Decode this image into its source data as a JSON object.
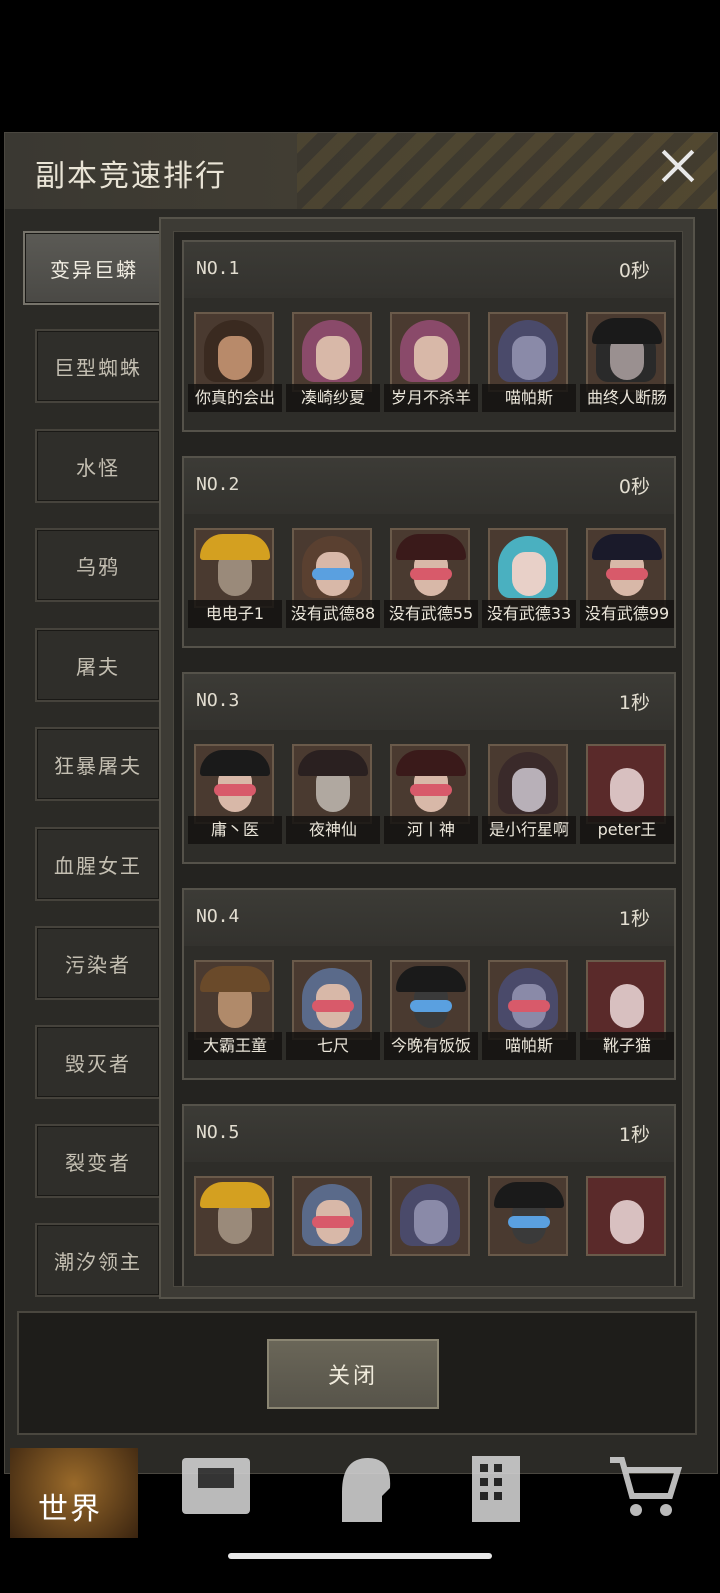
{
  "dialog": {
    "title": "副本竞速排行",
    "close_button": "关闭"
  },
  "sidebar": [
    {
      "label": "变异巨蟒",
      "active": true
    },
    {
      "label": "巨型蜘蛛"
    },
    {
      "label": "水怪"
    },
    {
      "label": "乌鸦"
    },
    {
      "label": "屠夫"
    },
    {
      "label": "狂暴屠夫"
    },
    {
      "label": "血腥女王"
    },
    {
      "label": "污染者"
    },
    {
      "label": "毁灭者"
    },
    {
      "label": "裂变者"
    },
    {
      "label": "潮汐领主"
    }
  ],
  "rankings": [
    {
      "rank": "NO.1",
      "time": "0秒",
      "players": [
        "你真的会出",
        "凑崎纱夏",
        "岁月不杀羊",
        "喵帕斯",
        "曲终人断肠"
      ]
    },
    {
      "rank": "NO.2",
      "time": "0秒",
      "players": [
        "电电子1",
        "没有武德88",
        "没有武德55",
        "没有武德33",
        "没有武德99"
      ]
    },
    {
      "rank": "NO.3",
      "time": "1秒",
      "players": [
        "庸丶医",
        "夜神仙",
        "河丨神",
        "是小行星啊",
        "peter王"
      ]
    },
    {
      "rank": "NO.4",
      "time": "1秒",
      "players": [
        "大霸王童",
        "七尺",
        "今晚有饭饭",
        "喵帕斯",
        "靴子猫"
      ]
    },
    {
      "rank": "NO.5",
      "time": "1秒",
      "players": []
    }
  ],
  "bottom_nav": {
    "world_label": "世界",
    "icons": [
      "backpack-icon",
      "character-icon",
      "building-icon",
      "shop-cart-icon"
    ]
  },
  "colors": {
    "panel_bg": "#2b2a26",
    "accent": "#8a8572"
  }
}
